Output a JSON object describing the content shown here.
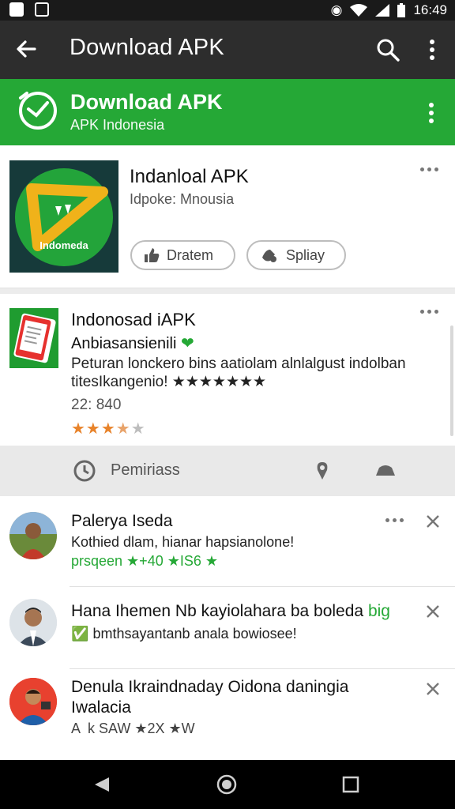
{
  "status_bar": {
    "time": "16:49"
  },
  "app_bar": {
    "title": "Download APK"
  },
  "banner": {
    "title": "Download APK",
    "subtitle": "APK Indonesia"
  },
  "card1": {
    "title": "Indanloal APK",
    "subtitle": "Idpoke: Mnousia",
    "icon_text": "Indomeda",
    "button1": "Dratem",
    "button2": "Spliay"
  },
  "card2": {
    "title": "Indonosad iAPK",
    "subtitle": "Anbiasansienili",
    "description_line1": "Peturan lonckero bins aatiolam alnlalgust indolban",
    "description_line2": "titesIkangenio! ★★★★★★★",
    "count": "22: 840",
    "rating_stars": "★★★★★",
    "rating_value": 3.5
  },
  "action_bar": {
    "label": "Pemiriass"
  },
  "notifications": [
    {
      "name": "Palerya Iseda",
      "line1": "Kothied dlam, hianar hapsianolone!",
      "line2": "prsqeen ★+40 ★IS6 ★"
    },
    {
      "name": "Hana Ihemen Nb kayiolahara ba boleda",
      "name_suffix": "big",
      "line1": "bmthsayantanb anala bowiosee!"
    },
    {
      "name": "Denula Ikraindnaday Oidona daningia",
      "name_line2": "Iwalacia",
      "line1": "A  k SAW ★2X ★W"
    }
  ],
  "colors": {
    "green": "#25a836",
    "app_bar": "#2d2d2d",
    "star": "#f5b400"
  }
}
